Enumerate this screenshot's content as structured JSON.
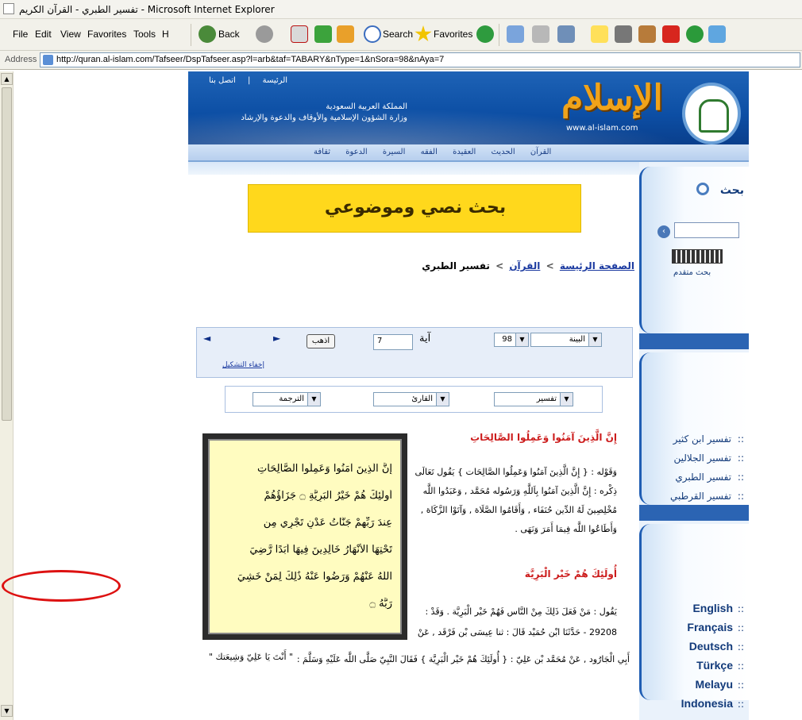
{
  "window": {
    "title": "تفسير الطبري - القرآن الكريم - Microsoft Internet Explorer"
  },
  "menu": {
    "items": [
      "File",
      "Edit",
      "View",
      "Favorites",
      "Tools",
      "H"
    ]
  },
  "toolbar": {
    "back_label": "Back",
    "search_label": "Search",
    "favorites_label": "Favorites"
  },
  "address": {
    "label": "Address",
    "url": "http://quran.al-islam.com/Tafseer/DspTafseer.asp?l=arb&taf=TABARY&nType=1&nSora=98&nAya=7"
  },
  "site": {
    "toplinks": [
      "الرئيسة",
      "|",
      "اتصل بنا"
    ],
    "ministry_lines": [
      "المملكة العربية السعودية",
      "وزارة الشؤون الإسلامية والأوقاف والدعوة والإرشاد"
    ],
    "logo_text": "الإسلام",
    "logo_url": "www.al-islam.com",
    "nav": [
      "القرآن",
      "الحديث",
      "العقيدة",
      "الفقه",
      "السيرة",
      "الدعوة",
      "ثقافة"
    ],
    "ad_text": "بحث نصي وموضوعي"
  },
  "breadcrumb": {
    "home": "الصفحة الرئيسة",
    "quran": "القرآن",
    "current": "تفسير الطبري",
    "sep": ">"
  },
  "selector": {
    "sura_name": "البينة",
    "sura_number": "98",
    "aya_label": "آية",
    "aya_value": "7",
    "go_label": "اذهب",
    "hide_diacritics": "إخفاء التشكيل",
    "prev_arrow": "◄",
    "next_arrow": "►"
  },
  "options": {
    "tafsir": "تفسير",
    "reciter": "القارئ",
    "translation": "الترجمة"
  },
  "quran_text": {
    "lines": [
      "إِنَّ الَّذِينَ آمَنُوا وَعَمِلُوا الصَّالِحَاتِ",
      "أُولَٰئِكَ هُمْ خَيْرُ الْبَرِيَّةِ ۝ جَزَاؤُهُمْ",
      "عِندَ رَبِّهِمْ جَنَّاتُ عَدْنٍ تَجْرِي مِن",
      "تَحْتِهَا الْأَنْهَارُ خَالِدِينَ فِيهَا أَبَدًا رَّضِيَ",
      "اللَّهُ عَنْهُمْ وَرَضُوا عَنْهُ ذَٰلِكَ لِمَنْ خَشِيَ",
      "رَبَّهُ ۝"
    ]
  },
  "tafsir": {
    "heading1": "إِنَّ الَّذِينَ آمَنُوا وَعَمِلُوا الصَّالِحَاتِ",
    "para1": [
      "وَقَوْله : { إِنَّ الَّذِينَ آمَنُوا وَعَمِلُوا الصَّالِحَات } يَقُول تَعَالَى",
      "ذِكْره : إِنَّ الَّذِينَ آمَنُوا بِاَللَّهِ وَرَسُوله مُحَمَّد , وَعَبَدُوا اللَّه",
      "مُخْلِصِينَ لَهُ الدِّين حُنَفَاء , وَأَقَامُوا الصَّلَاة , وَآتَوْا الزَّكَاة ,",
      "وَأَطَاعُوا اللَّه فِيمَا أَمَرَ وَنَهَى ."
    ],
    "heading2": "أُولَئِكَ هُمْ خَيْر الْبَرِيَّة",
    "para2": [
      "يَقُول : مَنْ فَعَلَ ذَلِكَ مِنْ النَّاس فَهُمْ خَيْر الْبَرِيَّة . وَقَدْ :",
      "29208 - حَدَّثَنَا ابْن حُمَيْد قَالَ : ثنا عِيسَى بْن فَرْقَد , عَنْ",
      "أَبِي الْجَارُود , عَنْ مُحَمَّد بْن عَلِيّ : { أُولَئِكَ هُمْ خَيْر الْبَرِيَّة } فَقَالَ النَّبِيّ صَلَّى اللَّه عَلَيْهِ وَسَلَّمَ :"
    ],
    "highlight": "\" أَنْتَ يَا عَلِيّ وَشِيعَتك \""
  },
  "sidebar": {
    "search_title": "بحث",
    "advanced_search": "بحث متقدم",
    "tafsir_links": [
      "تفسير ابن كثير",
      "تفسير الجلالين",
      "تفسير الطبري",
      "تفسير القرطبي"
    ],
    "bullet": "::",
    "languages": [
      "English",
      "Français",
      "Deutsch",
      "Türkçe",
      "Melayu",
      "Indonesia"
    ]
  },
  "colors": {
    "banner_blue": "#0c4ea4",
    "ad_yellow": "#ffd81c",
    "heading_red": "#cc1b1b",
    "link_blue": "#1b3aa0",
    "annotation_red": "#dd1111"
  }
}
